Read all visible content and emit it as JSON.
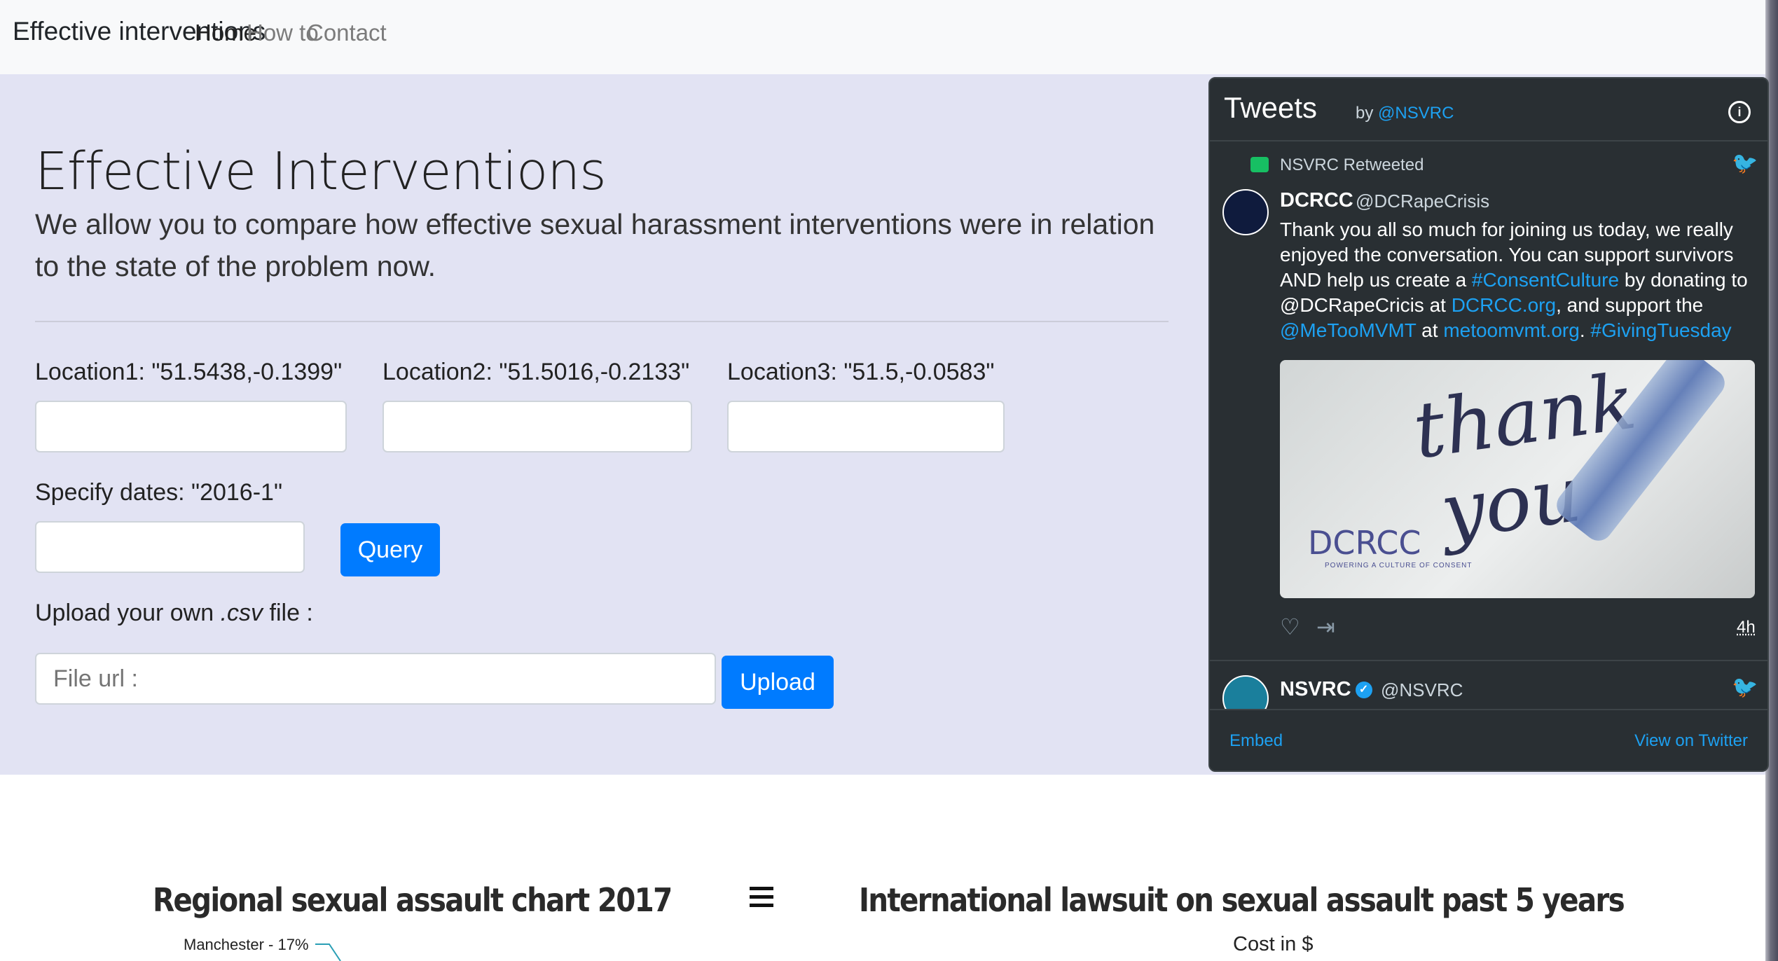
{
  "navbar": {
    "brand": "Effective interventions",
    "links": [
      "Home",
      "How to",
      "Contact"
    ]
  },
  "hero": {
    "title": "Effective Interventions",
    "lead": "We allow you to compare how effective sexual harassment interventions were in relation to the state of the problem now."
  },
  "form": {
    "location1_label": "Location1: \"51.5438,-0.1399\"",
    "location2_label": "Location2: \"51.5016,-0.2133\"",
    "location3_label": "Location3: \"51.5,-0.0583\"",
    "dates_label": "Specify dates: \"2016-1\"",
    "query_button": "Query",
    "upload_label_pre": "Upload your own ",
    "upload_label_ext": ".csv",
    "upload_label_post": " file :",
    "file_placeholder": "File url :",
    "upload_button": "Upload"
  },
  "twitter": {
    "title": "Tweets",
    "by": "by",
    "handle": "@NSVRC",
    "retweeted": "NSVRC Retweeted",
    "tweet1": {
      "name": "DCRCC",
      "user": "@DCRapeCrisis",
      "text_parts": [
        "Thank you all so much for joining us today, we really enjoyed the conversation. You can support survivors AND help us create a ",
        "#ConsentCulture",
        " by donating to @DCRapeCricis at ",
        "DCRCC.org",
        ", and support the ",
        "@MeTooMVMT",
        " at ",
        "metoomvmt.org",
        ". ",
        "#GivingTuesday"
      ],
      "image_text_1": "thank",
      "image_text_2": "you",
      "image_logo": "DCRCC",
      "image_logo_sub": "POWERING A CULTURE OF CONSENT",
      "time": "4h"
    },
    "tweet2": {
      "name": "NSVRC",
      "user": "@NSVRC"
    },
    "footer_embed": "Embed",
    "footer_view": "View on Twitter"
  },
  "charts": {
    "left_title": "Regional sexual assault chart 2017",
    "right_title": "International lawsuit on sexual assault past 5 years",
    "pie_label": "Manchester - 17%",
    "right_ylabel": "Cost in $"
  },
  "colors": {
    "jumbotron_bg": "#e2e3f3",
    "primary": "#007bff",
    "twitter_bg": "#292f33",
    "twitter_link": "#1da1f2"
  }
}
